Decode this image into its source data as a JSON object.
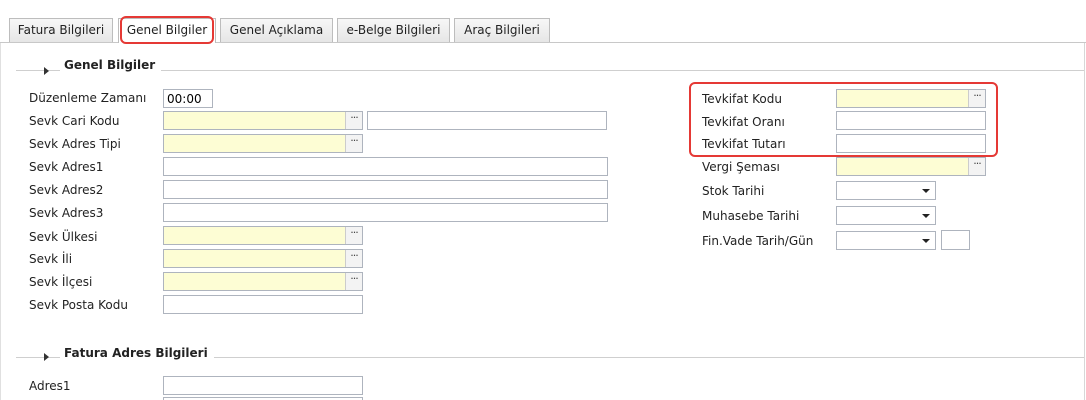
{
  "tabs": [
    {
      "label": "Fatura Bilgileri"
    },
    {
      "label": "Genel Bilgiler"
    },
    {
      "label": "Genel Açıklama"
    },
    {
      "label": "e-Belge Bilgileri"
    },
    {
      "label": "Araç Bilgileri"
    }
  ],
  "active_tab": "Genel Bilgiler",
  "highlight_color": "#e53935",
  "required_field_color": "#fdfdd4",
  "section_genel": {
    "title": "Genel Bilgiler",
    "left_fields": {
      "duzenleme_zamani": {
        "label": "Düzenleme Zamanı",
        "value": "00:00"
      },
      "sevk_cari_kodu": {
        "label": "Sevk Cari Kodu",
        "value": "",
        "name_value": ""
      },
      "sevk_adres_tipi": {
        "label": "Sevk Adres Tipi",
        "value": ""
      },
      "sevk_adres1": {
        "label": "Sevk Adres1",
        "value": ""
      },
      "sevk_adres2": {
        "label": "Sevk Adres2",
        "value": ""
      },
      "sevk_adres3": {
        "label": "Sevk Adres3",
        "value": ""
      },
      "sevk_ulkesi": {
        "label": "Sevk Ülkesi",
        "value": ""
      },
      "sevk_ili": {
        "label": "Sevk İli",
        "value": ""
      },
      "sevk_ilcesi": {
        "label": "Sevk İlçesi",
        "value": ""
      },
      "sevk_posta_kodu": {
        "label": "Sevk Posta Kodu",
        "value": ""
      }
    },
    "right_fields": {
      "tevkifat_kodu": {
        "label": "Tevkifat Kodu",
        "value": ""
      },
      "tevkifat_orani": {
        "label": "Tevkifat Oranı",
        "value": ""
      },
      "tevkifat_tutari": {
        "label": "Tevkifat Tutarı",
        "value": ""
      },
      "vergi_semasi": {
        "label": "Vergi Şeması",
        "value": ""
      },
      "stok_tarihi": {
        "label": "Stok Tarihi",
        "value": ""
      },
      "muhasebe_tarihi": {
        "label": "Muhasebe Tarihi",
        "value": ""
      },
      "fin_vade": {
        "label": "Fin.Vade Tarih/Gün",
        "value": "",
        "days": ""
      }
    }
  },
  "section_fatura_adres": {
    "title": "Fatura Adres Bilgileri",
    "fields": {
      "adres1": {
        "label": "Adres1",
        "value": ""
      }
    }
  },
  "icons": {
    "lookup": "ellipsis-icon",
    "dropdown": "caret-down-icon",
    "section": "caret-right-icon"
  }
}
